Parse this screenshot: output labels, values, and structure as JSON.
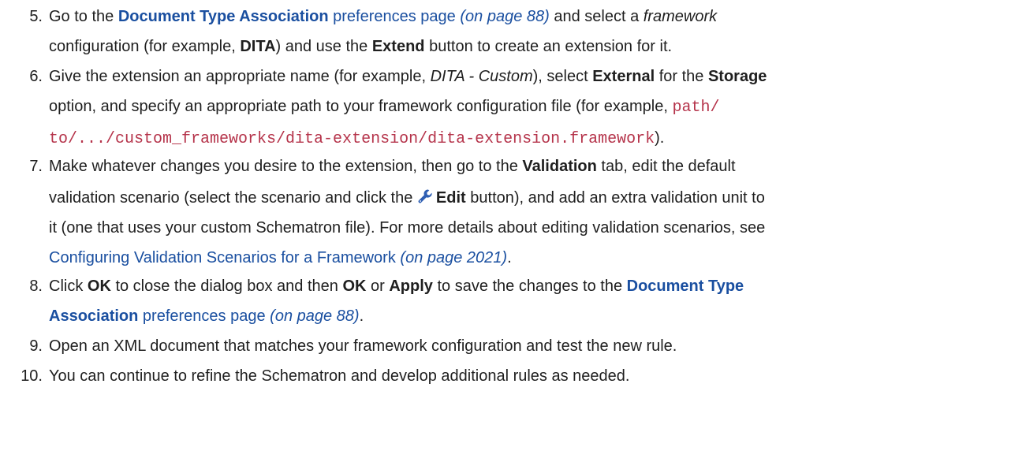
{
  "steps": [
    {
      "num": "5.",
      "p1": "Go to the ",
      "link_bold": "Document Type Association",
      "link_rest": " preferences page",
      "page_ref": "(on page 88)",
      "p2": " and select a ",
      "italic": "framework",
      "p3": "configuration (for example, ",
      "bold_dita": "DITA",
      "p4": ") and use the ",
      "bold_extend": "Extend",
      "p5": " button to create an extension for it."
    },
    {
      "num": "6.",
      "p1": "Give the extension an appropriate name (for example, ",
      "italic": "DITA - Custom",
      "p2": "), select ",
      "bold_external": "External",
      "p3": " for the ",
      "bold_storage": "Storage",
      "p4": "option, and specify an appropriate path to your framework configuration file (for example, ",
      "code1": "path/",
      "code2": "to/.../custom_frameworks/dita-extension/dita-extension.framework",
      "p5": ")."
    },
    {
      "num": "7.",
      "p1": "Make whatever changes you desire to the extension, then go to the ",
      "bold_validation": "Validation",
      "p2": " tab, edit the default",
      "p3": "validation scenario (select the scenario and click the ",
      "icon": "wrench-icon",
      "bold_edit": "Edit",
      "p4": " button), and add an extra validation unit to",
      "p5": "it (one that uses your custom Schematron file). For more details about editing validation scenarios, see",
      "link": "Configuring Validation Scenarios for a Framework",
      "page_ref": "(on page 2021)",
      "p6": "."
    },
    {
      "num": "8.",
      "p1": "Click ",
      "bold_ok": "OK",
      "p2": " to close the dialog box and then ",
      "bold_ok2": "OK",
      "p3": " or ",
      "bold_apply": "Apply",
      "p4": " to save the changes to the ",
      "link_bold1": "Document Type",
      "link_bold2": "Association",
      "link_rest": " preferences page",
      "page_ref": "(on page 88)",
      "p5": "."
    },
    {
      "num": "9.",
      "text": "Open an XML document that matches your framework configuration and test the new rule."
    },
    {
      "num": "10.",
      "text": "You can continue to refine the Schematron and develop additional rules as needed."
    }
  ]
}
